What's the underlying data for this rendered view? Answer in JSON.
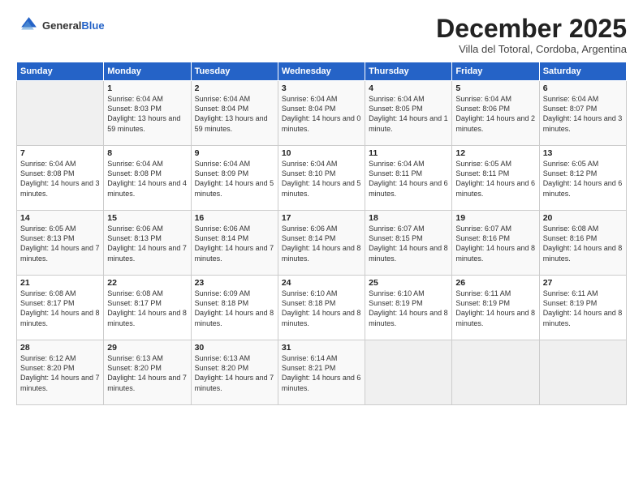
{
  "header": {
    "logo_general": "General",
    "logo_blue": "Blue",
    "month_title": "December 2025",
    "subtitle": "Villa del Totoral, Cordoba, Argentina"
  },
  "days_of_week": [
    "Sunday",
    "Monday",
    "Tuesday",
    "Wednesday",
    "Thursday",
    "Friday",
    "Saturday"
  ],
  "weeks": [
    [
      {
        "day": "",
        "empty": true
      },
      {
        "day": "1",
        "sunrise": "Sunrise: 6:04 AM",
        "sunset": "Sunset: 8:03 PM",
        "daylight": "Daylight: 13 hours and 59 minutes."
      },
      {
        "day": "2",
        "sunrise": "Sunrise: 6:04 AM",
        "sunset": "Sunset: 8:04 PM",
        "daylight": "Daylight: 13 hours and 59 minutes."
      },
      {
        "day": "3",
        "sunrise": "Sunrise: 6:04 AM",
        "sunset": "Sunset: 8:04 PM",
        "daylight": "Daylight: 14 hours and 0 minutes."
      },
      {
        "day": "4",
        "sunrise": "Sunrise: 6:04 AM",
        "sunset": "Sunset: 8:05 PM",
        "daylight": "Daylight: 14 hours and 1 minute."
      },
      {
        "day": "5",
        "sunrise": "Sunrise: 6:04 AM",
        "sunset": "Sunset: 8:06 PM",
        "daylight": "Daylight: 14 hours and 2 minutes."
      },
      {
        "day": "6",
        "sunrise": "Sunrise: 6:04 AM",
        "sunset": "Sunset: 8:07 PM",
        "daylight": "Daylight: 14 hours and 3 minutes."
      }
    ],
    [
      {
        "day": "7",
        "sunrise": "Sunrise: 6:04 AM",
        "sunset": "Sunset: 8:08 PM",
        "daylight": "Daylight: 14 hours and 3 minutes."
      },
      {
        "day": "8",
        "sunrise": "Sunrise: 6:04 AM",
        "sunset": "Sunset: 8:08 PM",
        "daylight": "Daylight: 14 hours and 4 minutes."
      },
      {
        "day": "9",
        "sunrise": "Sunrise: 6:04 AM",
        "sunset": "Sunset: 8:09 PM",
        "daylight": "Daylight: 14 hours and 5 minutes."
      },
      {
        "day": "10",
        "sunrise": "Sunrise: 6:04 AM",
        "sunset": "Sunset: 8:10 PM",
        "daylight": "Daylight: 14 hours and 5 minutes."
      },
      {
        "day": "11",
        "sunrise": "Sunrise: 6:04 AM",
        "sunset": "Sunset: 8:11 PM",
        "daylight": "Daylight: 14 hours and 6 minutes."
      },
      {
        "day": "12",
        "sunrise": "Sunrise: 6:05 AM",
        "sunset": "Sunset: 8:11 PM",
        "daylight": "Daylight: 14 hours and 6 minutes."
      },
      {
        "day": "13",
        "sunrise": "Sunrise: 6:05 AM",
        "sunset": "Sunset: 8:12 PM",
        "daylight": "Daylight: 14 hours and 6 minutes."
      }
    ],
    [
      {
        "day": "14",
        "sunrise": "Sunrise: 6:05 AM",
        "sunset": "Sunset: 8:13 PM",
        "daylight": "Daylight: 14 hours and 7 minutes."
      },
      {
        "day": "15",
        "sunrise": "Sunrise: 6:06 AM",
        "sunset": "Sunset: 8:13 PM",
        "daylight": "Daylight: 14 hours and 7 minutes."
      },
      {
        "day": "16",
        "sunrise": "Sunrise: 6:06 AM",
        "sunset": "Sunset: 8:14 PM",
        "daylight": "Daylight: 14 hours and 7 minutes."
      },
      {
        "day": "17",
        "sunrise": "Sunrise: 6:06 AM",
        "sunset": "Sunset: 8:14 PM",
        "daylight": "Daylight: 14 hours and 8 minutes."
      },
      {
        "day": "18",
        "sunrise": "Sunrise: 6:07 AM",
        "sunset": "Sunset: 8:15 PM",
        "daylight": "Daylight: 14 hours and 8 minutes."
      },
      {
        "day": "19",
        "sunrise": "Sunrise: 6:07 AM",
        "sunset": "Sunset: 8:16 PM",
        "daylight": "Daylight: 14 hours and 8 minutes."
      },
      {
        "day": "20",
        "sunrise": "Sunrise: 6:08 AM",
        "sunset": "Sunset: 8:16 PM",
        "daylight": "Daylight: 14 hours and 8 minutes."
      }
    ],
    [
      {
        "day": "21",
        "sunrise": "Sunrise: 6:08 AM",
        "sunset": "Sunset: 8:17 PM",
        "daylight": "Daylight: 14 hours and 8 minutes."
      },
      {
        "day": "22",
        "sunrise": "Sunrise: 6:08 AM",
        "sunset": "Sunset: 8:17 PM",
        "daylight": "Daylight: 14 hours and 8 minutes."
      },
      {
        "day": "23",
        "sunrise": "Sunrise: 6:09 AM",
        "sunset": "Sunset: 8:18 PM",
        "daylight": "Daylight: 14 hours and 8 minutes."
      },
      {
        "day": "24",
        "sunrise": "Sunrise: 6:10 AM",
        "sunset": "Sunset: 8:18 PM",
        "daylight": "Daylight: 14 hours and 8 minutes."
      },
      {
        "day": "25",
        "sunrise": "Sunrise: 6:10 AM",
        "sunset": "Sunset: 8:19 PM",
        "daylight": "Daylight: 14 hours and 8 minutes."
      },
      {
        "day": "26",
        "sunrise": "Sunrise: 6:11 AM",
        "sunset": "Sunset: 8:19 PM",
        "daylight": "Daylight: 14 hours and 8 minutes."
      },
      {
        "day": "27",
        "sunrise": "Sunrise: 6:11 AM",
        "sunset": "Sunset: 8:19 PM",
        "daylight": "Daylight: 14 hours and 8 minutes."
      }
    ],
    [
      {
        "day": "28",
        "sunrise": "Sunrise: 6:12 AM",
        "sunset": "Sunset: 8:20 PM",
        "daylight": "Daylight: 14 hours and 7 minutes."
      },
      {
        "day": "29",
        "sunrise": "Sunrise: 6:13 AM",
        "sunset": "Sunset: 8:20 PM",
        "daylight": "Daylight: 14 hours and 7 minutes."
      },
      {
        "day": "30",
        "sunrise": "Sunrise: 6:13 AM",
        "sunset": "Sunset: 8:20 PM",
        "daylight": "Daylight: 14 hours and 7 minutes."
      },
      {
        "day": "31",
        "sunrise": "Sunrise: 6:14 AM",
        "sunset": "Sunset: 8:21 PM",
        "daylight": "Daylight: 14 hours and 6 minutes."
      },
      {
        "day": "",
        "empty": true
      },
      {
        "day": "",
        "empty": true
      },
      {
        "day": "",
        "empty": true
      }
    ]
  ]
}
